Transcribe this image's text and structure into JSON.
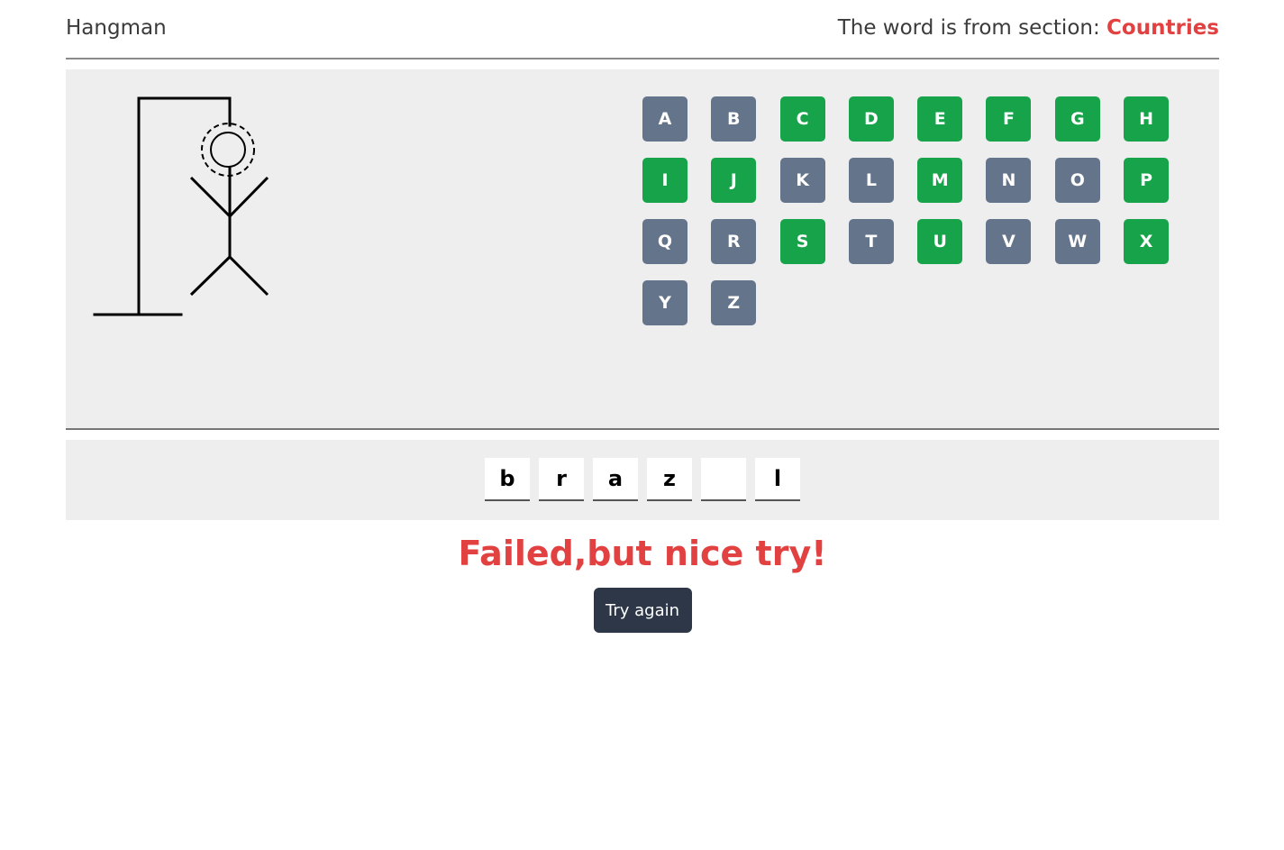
{
  "header": {
    "title": "Hangman",
    "section_prefix": "The word is from section:",
    "category": "Countries"
  },
  "keyboard": {
    "keys": [
      {
        "letter": "A",
        "state": "used"
      },
      {
        "letter": "B",
        "state": "used"
      },
      {
        "letter": "C",
        "state": "available"
      },
      {
        "letter": "D",
        "state": "available"
      },
      {
        "letter": "E",
        "state": "available"
      },
      {
        "letter": "F",
        "state": "available"
      },
      {
        "letter": "G",
        "state": "available"
      },
      {
        "letter": "H",
        "state": "available"
      },
      {
        "letter": "I",
        "state": "available"
      },
      {
        "letter": "J",
        "state": "available"
      },
      {
        "letter": "K",
        "state": "used"
      },
      {
        "letter": "L",
        "state": "used"
      },
      {
        "letter": "M",
        "state": "available"
      },
      {
        "letter": "N",
        "state": "used"
      },
      {
        "letter": "O",
        "state": "used"
      },
      {
        "letter": "P",
        "state": "available"
      },
      {
        "letter": "Q",
        "state": "used"
      },
      {
        "letter": "R",
        "state": "used"
      },
      {
        "letter": "S",
        "state": "available"
      },
      {
        "letter": "T",
        "state": "used"
      },
      {
        "letter": "U",
        "state": "available"
      },
      {
        "letter": "V",
        "state": "used"
      },
      {
        "letter": "W",
        "state": "used"
      },
      {
        "letter": "X",
        "state": "available"
      },
      {
        "letter": "Y",
        "state": "used"
      },
      {
        "letter": "Z",
        "state": "used"
      }
    ]
  },
  "word": {
    "slots": [
      "b",
      "r",
      "a",
      "z",
      "",
      "l"
    ]
  },
  "result": {
    "message": "Failed,but nice try!",
    "retry_label": "Try again"
  },
  "colors": {
    "used_key": "#64748b",
    "available_key": "#16a34a",
    "accent_red": "#e24141",
    "button_dark": "#2d3748"
  }
}
